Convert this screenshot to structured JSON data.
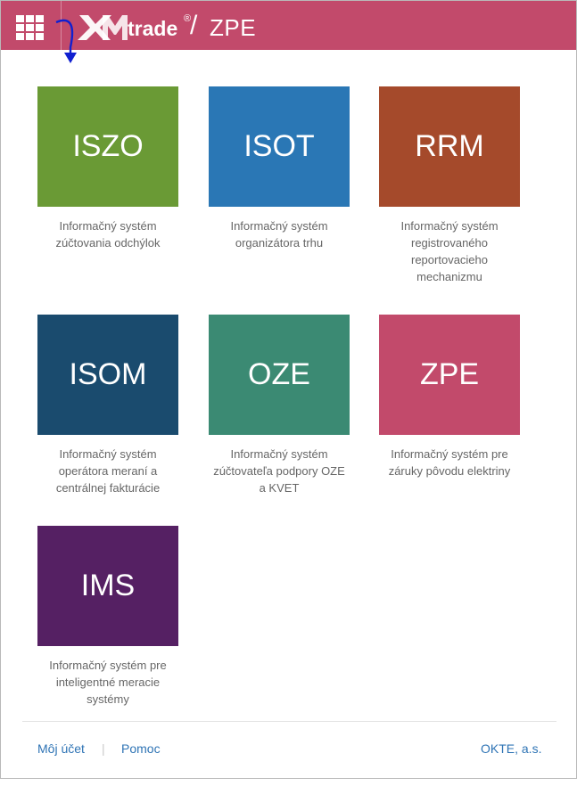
{
  "header": {
    "brand": "XMtrade",
    "brand_mark": "®",
    "separator": "/",
    "app_title": "ZPE",
    "background": "#c24a6b"
  },
  "tiles": [
    {
      "code": "ISZO",
      "desc_lines": [
        "Informačný systém",
        "zúčtovania odchýlok"
      ],
      "color": "#6a9a35"
    },
    {
      "code": "ISOT",
      "desc_lines": [
        "Informačný systém",
        "organizátora trhu"
      ],
      "color": "#2a77b5"
    },
    {
      "code": "RRM",
      "desc_lines": [
        "Informačný systém",
        "registrovaného",
        "reportovacieho",
        "mechanizmu"
      ],
      "color": "#a54a2b"
    },
    {
      "code": "ISOM",
      "desc_lines": [
        "Informačný systém",
        "operátora meraní a",
        "centrálnej fakturácie"
      ],
      "color": "#1a4b6e"
    },
    {
      "code": "OZE",
      "desc_lines": [
        "Informačný systém",
        "zúčtovateľa podpory OZE",
        "a KVET"
      ],
      "color": "#3b8a73"
    },
    {
      "code": "ZPE",
      "desc_lines": [
        "Informačný systém pre",
        "záruky pôvodu elektriny"
      ],
      "color": "#c24a6b"
    },
    {
      "code": "IMS",
      "desc_lines": [
        "Informačný systém pre",
        "inteligentné meracie",
        "systémy"
      ],
      "color": "#552063"
    }
  ],
  "footer": {
    "account_label": "Môj účet",
    "separator": "|",
    "help_label": "Pomoc",
    "company_label": "OKTE, a.s."
  }
}
